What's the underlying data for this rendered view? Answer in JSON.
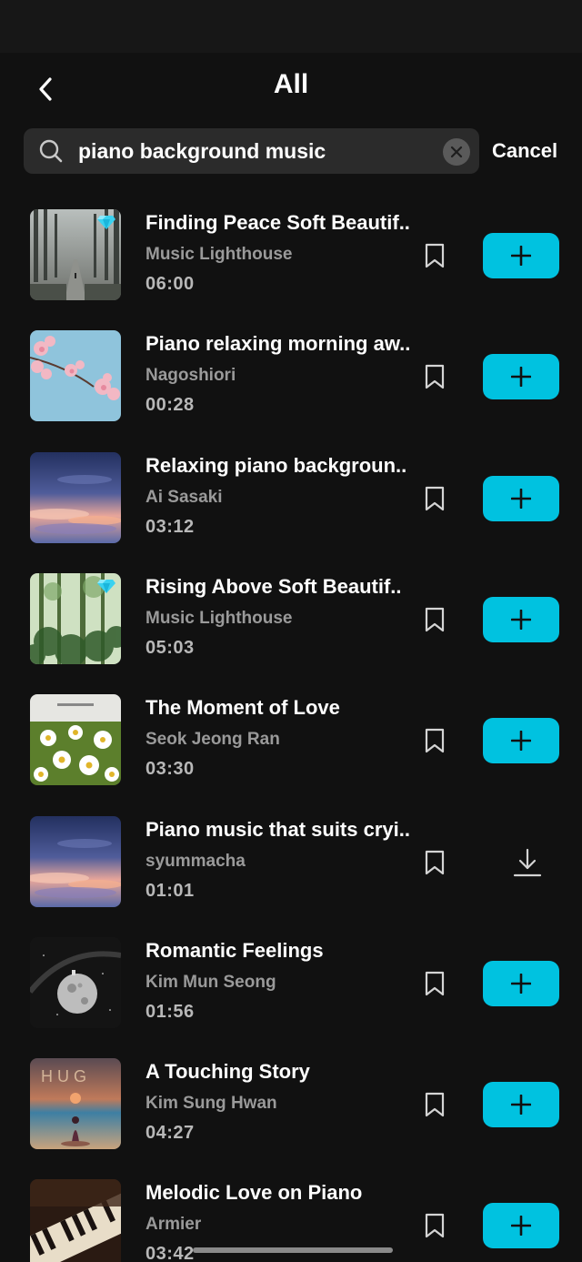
{
  "header": {
    "title": "All"
  },
  "search": {
    "query": "piano background music",
    "cancel_label": "Cancel"
  },
  "colors": {
    "accent": "#00c2e0",
    "background": "#111111",
    "search_bg": "#2b2b2b",
    "artist_text": "#9a9a9a",
    "premium_gem": "#39d2f0"
  },
  "tracks": [
    {
      "title": "Finding Peace Soft Beautif..",
      "artist": "Music Lighthouse",
      "duration": "06:00",
      "premium": true,
      "action": "add",
      "art": "foggy-forest-road"
    },
    {
      "title": "Piano relaxing morning aw..",
      "artist": "Nagoshiori",
      "duration": "00:28",
      "premium": false,
      "action": "add",
      "art": "cherry-blossom-sky"
    },
    {
      "title": "Relaxing piano backgroun..",
      "artist": "Ai Sasaki",
      "duration": "03:12",
      "premium": false,
      "action": "add",
      "art": "sunset-clouds"
    },
    {
      "title": "Rising Above Soft Beautif..",
      "artist": "Music Lighthouse",
      "duration": "05:03",
      "premium": true,
      "action": "add",
      "art": "green-forest"
    },
    {
      "title": "The Moment of Love",
      "artist": "Seok Jeong Ran",
      "duration": "03:30",
      "premium": false,
      "action": "add",
      "art": "daisy-field"
    },
    {
      "title": "Piano music that suits cryi..",
      "artist": "syummacha",
      "duration": "01:01",
      "premium": false,
      "action": "download",
      "art": "sunset-clouds"
    },
    {
      "title": "Romantic Feelings",
      "artist": "Kim Mun Seong",
      "duration": "01:56",
      "premium": false,
      "action": "add",
      "art": "moon-space"
    },
    {
      "title": "A Touching Story",
      "artist": "Kim Sung Hwan",
      "duration": "04:27",
      "premium": false,
      "action": "add",
      "art": "hug-beach"
    },
    {
      "title": "Melodic Love on Piano",
      "artist": "Armier",
      "duration": "03:42",
      "premium": false,
      "action": "add",
      "art": "piano-keys"
    }
  ]
}
